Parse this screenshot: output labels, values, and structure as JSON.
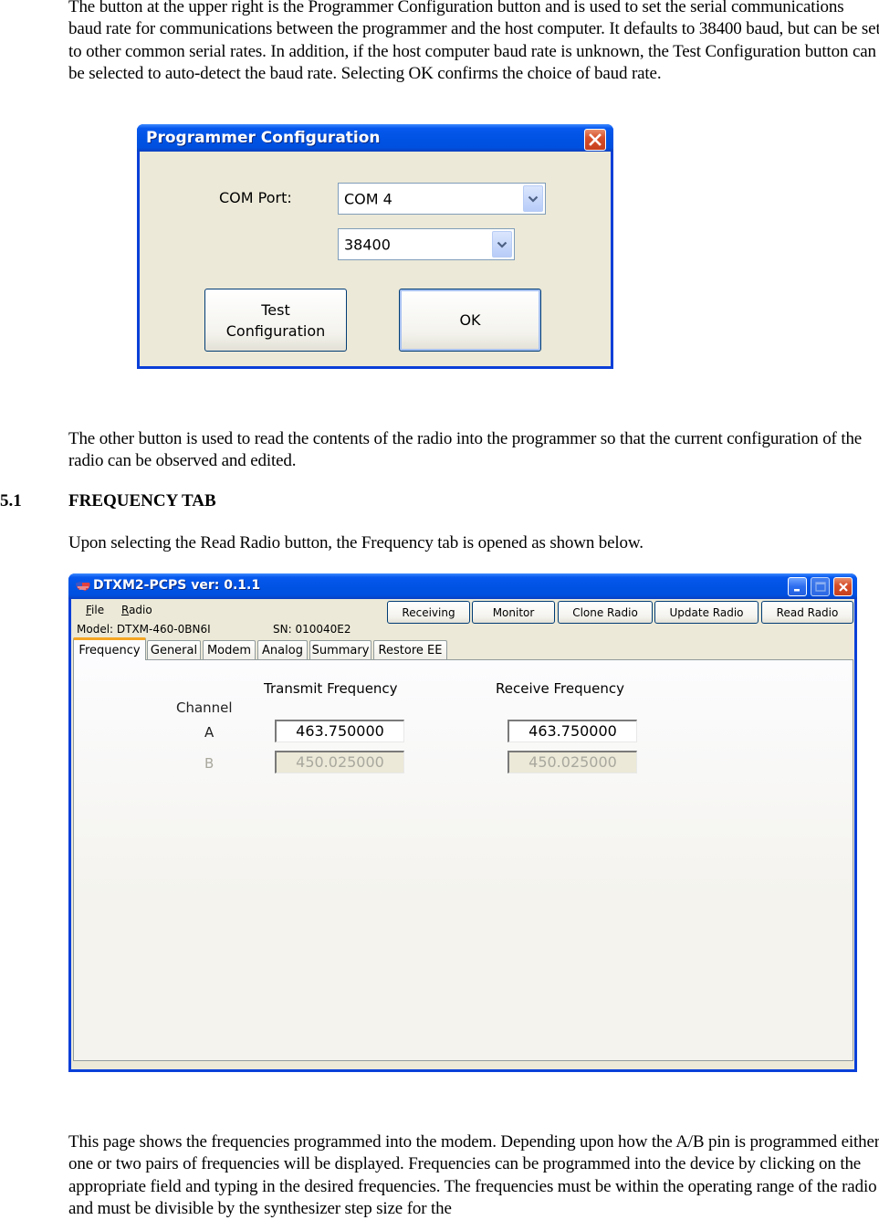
{
  "document": {
    "para1": "The button at the upper right is the Programmer Configuration button and is used to set the serial communications baud rate for communications between the programmer and the host computer. It defaults to 38400 baud, but can be set to other common serial rates. In addition, if the host computer baud rate is unknown, the Test Configuration button can be selected to auto-detect the baud rate. Selecting OK confirms the choice of baud rate.",
    "para2": "The other button is used to read the contents of the radio into the programmer so that the current configuration of the radio can be observed and edited.",
    "section_number": "5.1",
    "section_title": "FREQUENCY TAB",
    "para3": "Upon selecting the Read Radio button, the Frequency tab is opened as shown below.",
    "para4": "This page shows the frequencies programmed into the modem. Depending upon how the A/B pin is programmed either one or two pairs of frequencies will be displayed. Frequencies can be programmed into the device by clicking on the appropriate field and typing in the desired frequencies. The frequencies must be within the operating range of the radio and must be divisible by the synthesizer step size for the"
  },
  "config_dialog": {
    "title": "Programmer Configuration",
    "com_port_label": "COM Port:",
    "com_port_value": "COM 4",
    "baud_value": "38400",
    "test_button": "Test Configuration",
    "ok_button": "OK",
    "close_icon": "close-icon"
  },
  "app_window": {
    "title": "DTXM2-PCPS ver: 0.1.1",
    "app_icon": "flag-map-icon",
    "menu": [
      {
        "label": "File",
        "mnemonic": "F"
      },
      {
        "label": "Radio",
        "mnemonic": "R"
      }
    ],
    "toolbar_buttons": [
      "Receiving",
      "Monitor",
      "Clone Radio",
      "Update Radio",
      "Read Radio"
    ],
    "model_text": "Model: DTXM-460-0BN6I",
    "sn_text": "SN: 010040E2",
    "tabs": [
      "Frequency",
      "General",
      "Modem",
      "Analog",
      "Summary",
      "Restore EE"
    ],
    "active_tab": "Frequency",
    "frequency_tab": {
      "transmit_header": "Transmit Frequency",
      "receive_header": "Receive Frequency",
      "channel_label": "Channel",
      "channels": [
        {
          "name": "A",
          "tx": "463.750000",
          "rx": "463.750000",
          "enabled": true
        },
        {
          "name": "B",
          "tx": "450.025000",
          "rx": "450.025000",
          "enabled": false
        }
      ]
    }
  }
}
